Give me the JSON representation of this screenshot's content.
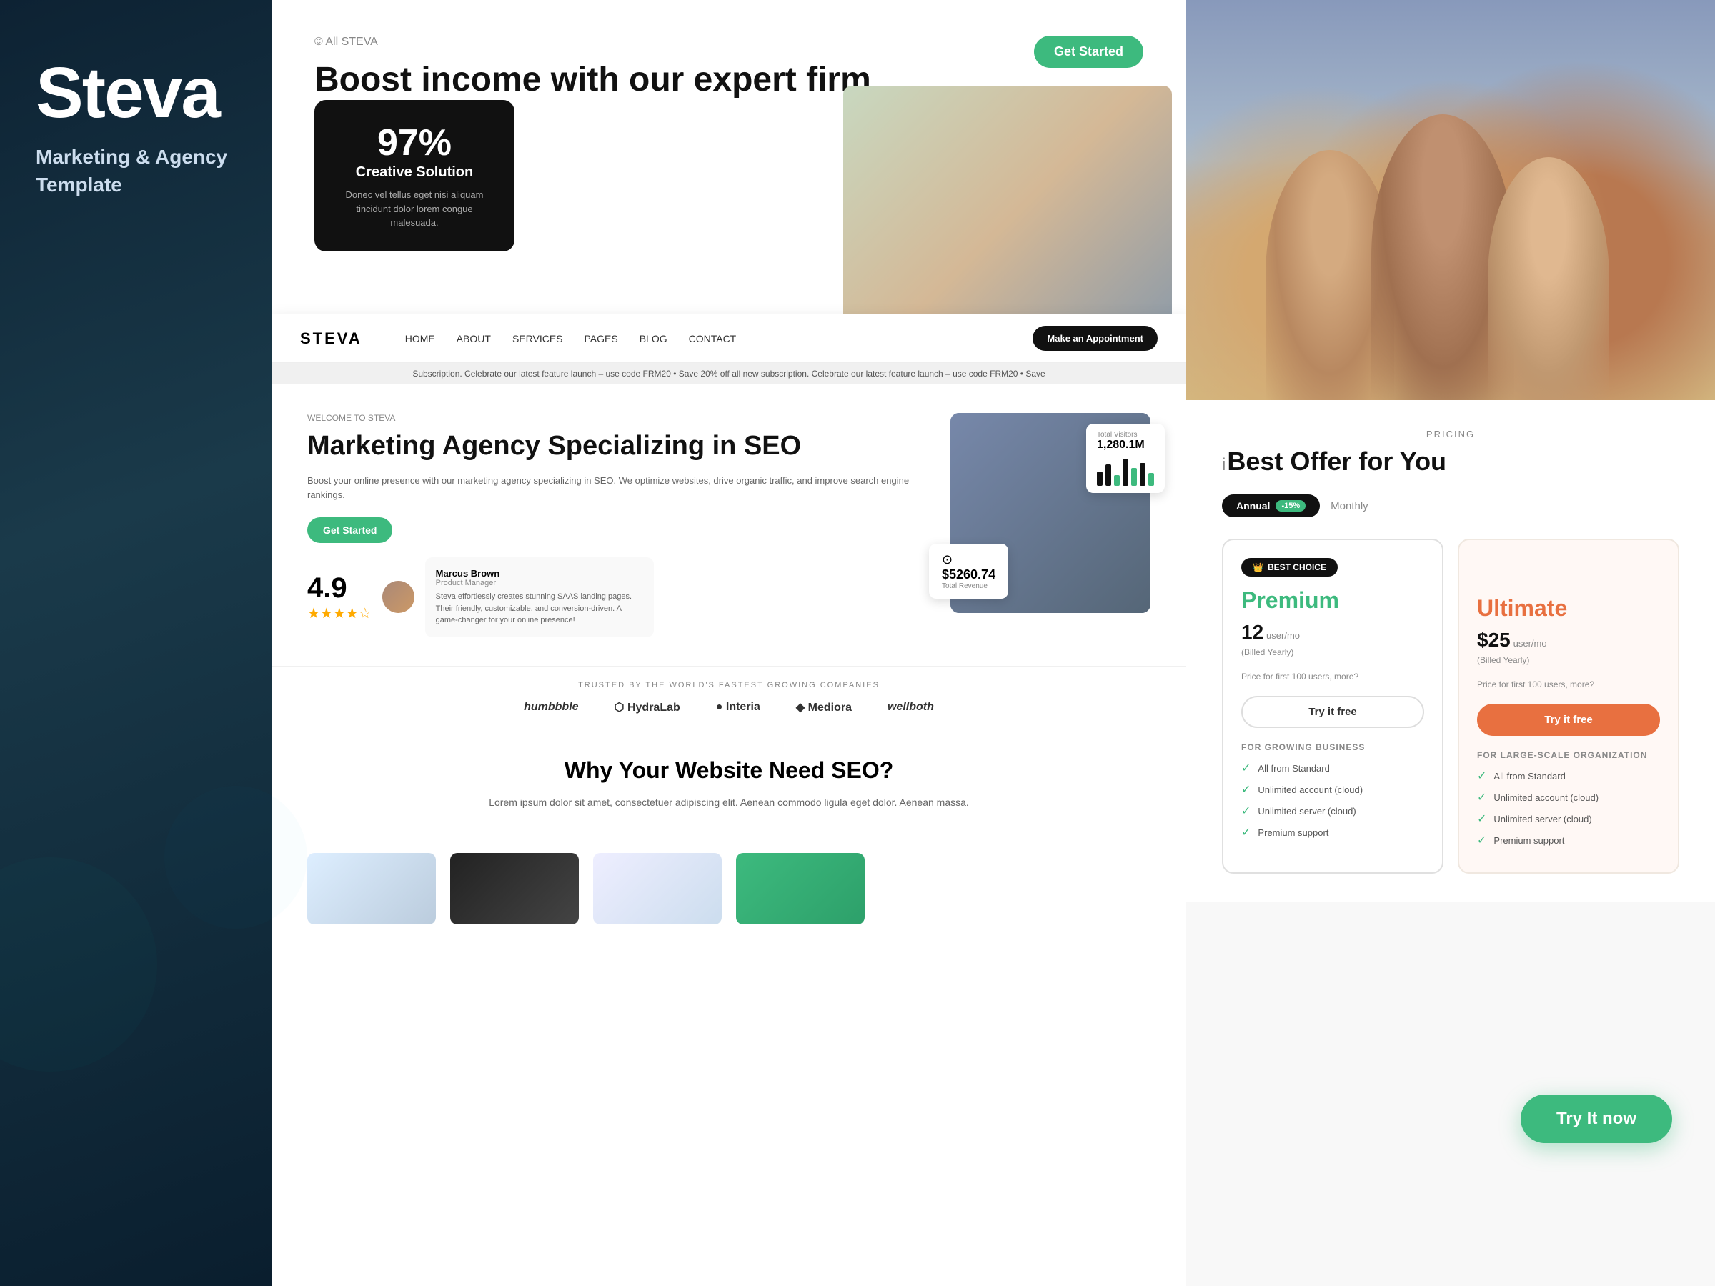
{
  "left_panel": {
    "logo": "Steva",
    "tagline": "Marketing & Agency Template"
  },
  "top_section": {
    "breadcrumb": "© All STEVA",
    "hero_headline": "Boost income with our expert firm",
    "get_started_label": "Get Started"
  },
  "stats_card": {
    "percent": "97%",
    "label": "Creative Solution",
    "description": "Donec vel tellus eget nisi aliquam tincidunt dolor lorem congue malesuada."
  },
  "website_mockup": {
    "nav": {
      "logo": "STEVA",
      "links": [
        "HOME",
        "ABOUT",
        "SERVICES",
        "PAGES",
        "BLOG",
        "CONTACT"
      ],
      "cta": "Make an Appointment"
    },
    "announcement": "Subscription. Celebrate our latest feature launch – use code FRM20 • Save 20% off all new subscription. Celebrate our latest feature launch – use code FRM20 • Save",
    "hero": {
      "welcome_label": "WELCOME TO STEVA",
      "title": "Marketing Agency Specializing in SEO",
      "description": "Boost your online presence with our marketing agency specializing in SEO. We optimize websites, drive organic traffic, and improve search engine rankings.",
      "cta": "Get Started",
      "rating": "4.9",
      "stars": "★★★★☆"
    },
    "analytics_card": {
      "label": "Total Visitors",
      "value": "1,280.1M",
      "indicator": "●"
    },
    "finance_card": {
      "amount": "$5260.74",
      "label": "Total Revenue"
    },
    "reviewer": {
      "name": "Marcus Brown",
      "title": "Product Manager",
      "text": "Steva effortlessly creates stunning SAAS landing pages. Their friendly, customizable, and conversion-driven. A game-changer for your online presence!"
    },
    "trusted_label": "TRUSTED BY THE WORLD'S FASTEST GROWING COMPANIES",
    "brands": [
      "humbbble",
      "HydraLab",
      "Interia",
      "Mediora",
      "wellboth"
    ],
    "why_seo_title": "Why Your Website Need SEO?",
    "why_seo_desc": "Lorem ipsum dolor sit amet, consectetuer adipiscing elit. Aenean commodo ligula eget dolor. Aenean massa."
  },
  "pricing": {
    "section_label": "PRICING",
    "headline": "Best Offer for You",
    "billing_toggle": {
      "annual_label": "Annual",
      "discount": "-15%",
      "monthly_label": "Monthly"
    },
    "best_choice_label": "BEST CHOICE",
    "plans": [
      {
        "name": "Premium",
        "price_number": "12",
        "price_unit": "user/mo",
        "billing_note": "(Billed Yearly)",
        "price_detail": "Price for first 100 users, more?",
        "cta": "Try it free",
        "for_label": "FOR GROWING BUSINESS",
        "features": [
          "All from Standard",
          "Unlimited account (cloud)",
          "Unlimited server (cloud)",
          "Premium support"
        ],
        "type": "premium"
      },
      {
        "name": "Ultimate",
        "price_number": "$25",
        "price_unit": "user/mo",
        "billing_note": "(Billed Yearly)",
        "price_detail": "Price for first 100 users, more?",
        "cta": "Try it free",
        "for_label": "FOR LARGE-SCALE ORGANIZATION",
        "features": [
          "All from Standard",
          "Unlimited account (cloud)",
          "Unlimited server (cloud)",
          "Premium support"
        ],
        "type": "ultimate"
      }
    ]
  },
  "try_now": {
    "label": "Try It now"
  }
}
